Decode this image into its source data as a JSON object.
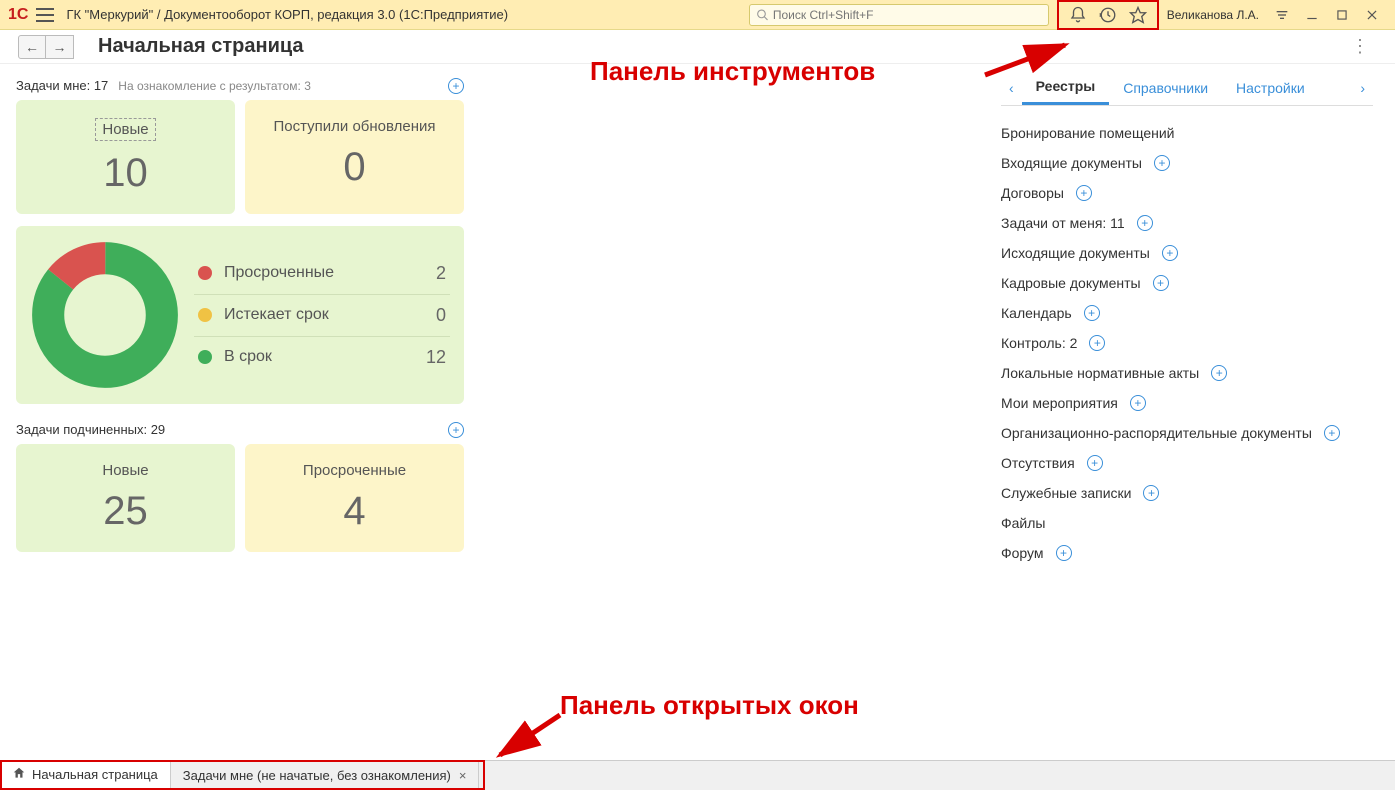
{
  "titlebar": {
    "app_title": "ГК \"Меркурий\" / Документооборот КОРП, редакция 3.0  (1С:Предприятие)",
    "search_placeholder": "Поиск Ctrl+Shift+F",
    "username": "Великанова Л.А."
  },
  "nav": {
    "page_title": "Начальная страница"
  },
  "tasks_mine": {
    "title": "Задачи мне: 17",
    "subtitle": "На ознакомление с результатом: 3",
    "card_new_label": "Новые",
    "card_new_value": "10",
    "card_updates_label": "Поступили обновления",
    "card_updates_value": "0"
  },
  "chart_data": {
    "type": "pie",
    "title": "",
    "categories": [
      "Просроченные",
      "Истекает срок",
      "В срок"
    ],
    "values": [
      2,
      0,
      12
    ],
    "colors": [
      "#d9534f",
      "#f0c244",
      "#3fae5a"
    ]
  },
  "donut_legend": [
    {
      "label": "Просроченные",
      "value": "2",
      "color": "#d9534f"
    },
    {
      "label": "Истекает срок",
      "value": "0",
      "color": "#f0c244"
    },
    {
      "label": "В срок",
      "value": "12",
      "color": "#3fae5a"
    }
  ],
  "tasks_sub": {
    "title": "Задачи подчиненных: 29",
    "card_new_label": "Новые",
    "card_new_value": "25",
    "card_overdue_label": "Просроченные",
    "card_overdue_value": "4"
  },
  "tabs": {
    "t1": "Реестры",
    "t2": "Справочники",
    "t3": "Настройки"
  },
  "registry": [
    {
      "label": "Бронирование помещений",
      "plus": false
    },
    {
      "label": "Входящие документы",
      "plus": true
    },
    {
      "label": "Договоры",
      "plus": true
    },
    {
      "label": "Задачи от меня: 11",
      "plus": true
    },
    {
      "label": "Исходящие документы",
      "plus": true
    },
    {
      "label": "Кадровые документы",
      "plus": true
    },
    {
      "label": "Календарь",
      "plus": true
    },
    {
      "label": "Контроль: 2",
      "plus": true
    },
    {
      "label": "Локальные нормативные акты",
      "plus": true
    },
    {
      "label": "Мои мероприятия",
      "plus": true
    },
    {
      "label": "Организационно-распорядительные документы",
      "plus": true
    },
    {
      "label": "Отсутствия",
      "plus": true
    },
    {
      "label": "Служебные записки",
      "plus": true
    },
    {
      "label": "Файлы",
      "plus": false
    },
    {
      "label": "Форум",
      "plus": true
    }
  ],
  "annotations": {
    "tools": "Панель инструментов",
    "windows": "Панель открытых окон"
  },
  "taskbar": {
    "home": "Начальная страница",
    "tab2": "Задачи мне (не начатые, без ознакомления)"
  }
}
